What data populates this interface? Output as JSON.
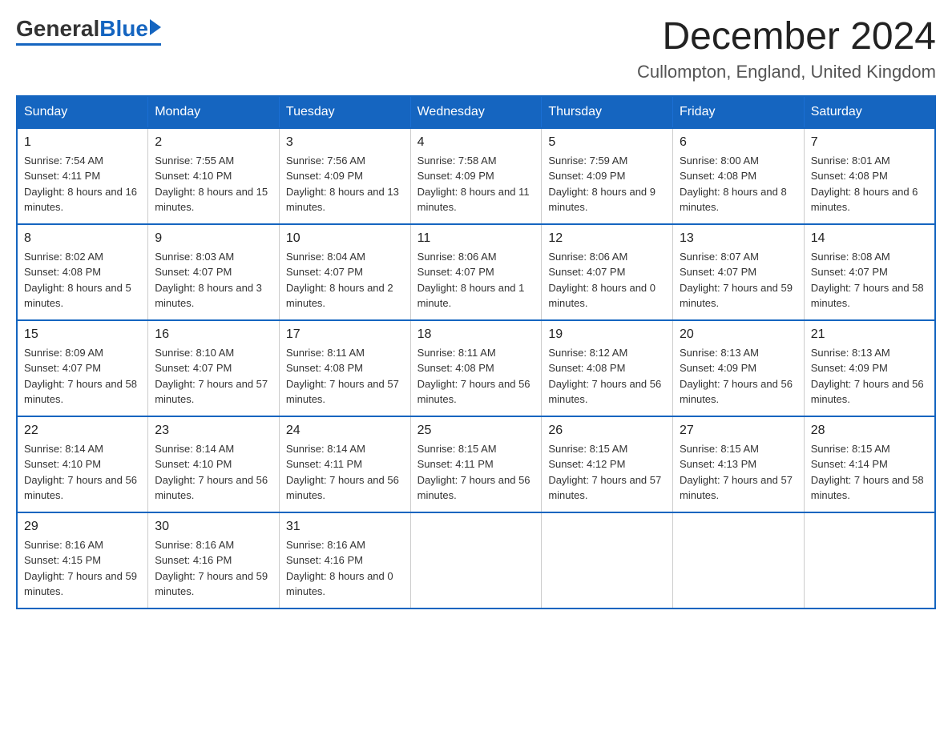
{
  "header": {
    "logo_general": "General",
    "logo_blue": "Blue",
    "month_title": "December 2024",
    "location": "Cullompton, England, United Kingdom"
  },
  "days_of_week": [
    "Sunday",
    "Monday",
    "Tuesday",
    "Wednesday",
    "Thursday",
    "Friday",
    "Saturday"
  ],
  "weeks": [
    [
      {
        "day": "1",
        "sunrise": "Sunrise: 7:54 AM",
        "sunset": "Sunset: 4:11 PM",
        "daylight": "Daylight: 8 hours and 16 minutes."
      },
      {
        "day": "2",
        "sunrise": "Sunrise: 7:55 AM",
        "sunset": "Sunset: 4:10 PM",
        "daylight": "Daylight: 8 hours and 15 minutes."
      },
      {
        "day": "3",
        "sunrise": "Sunrise: 7:56 AM",
        "sunset": "Sunset: 4:09 PM",
        "daylight": "Daylight: 8 hours and 13 minutes."
      },
      {
        "day": "4",
        "sunrise": "Sunrise: 7:58 AM",
        "sunset": "Sunset: 4:09 PM",
        "daylight": "Daylight: 8 hours and 11 minutes."
      },
      {
        "day": "5",
        "sunrise": "Sunrise: 7:59 AM",
        "sunset": "Sunset: 4:09 PM",
        "daylight": "Daylight: 8 hours and 9 minutes."
      },
      {
        "day": "6",
        "sunrise": "Sunrise: 8:00 AM",
        "sunset": "Sunset: 4:08 PM",
        "daylight": "Daylight: 8 hours and 8 minutes."
      },
      {
        "day": "7",
        "sunrise": "Sunrise: 8:01 AM",
        "sunset": "Sunset: 4:08 PM",
        "daylight": "Daylight: 8 hours and 6 minutes."
      }
    ],
    [
      {
        "day": "8",
        "sunrise": "Sunrise: 8:02 AM",
        "sunset": "Sunset: 4:08 PM",
        "daylight": "Daylight: 8 hours and 5 minutes."
      },
      {
        "day": "9",
        "sunrise": "Sunrise: 8:03 AM",
        "sunset": "Sunset: 4:07 PM",
        "daylight": "Daylight: 8 hours and 3 minutes."
      },
      {
        "day": "10",
        "sunrise": "Sunrise: 8:04 AM",
        "sunset": "Sunset: 4:07 PM",
        "daylight": "Daylight: 8 hours and 2 minutes."
      },
      {
        "day": "11",
        "sunrise": "Sunrise: 8:06 AM",
        "sunset": "Sunset: 4:07 PM",
        "daylight": "Daylight: 8 hours and 1 minute."
      },
      {
        "day": "12",
        "sunrise": "Sunrise: 8:06 AM",
        "sunset": "Sunset: 4:07 PM",
        "daylight": "Daylight: 8 hours and 0 minutes."
      },
      {
        "day": "13",
        "sunrise": "Sunrise: 8:07 AM",
        "sunset": "Sunset: 4:07 PM",
        "daylight": "Daylight: 7 hours and 59 minutes."
      },
      {
        "day": "14",
        "sunrise": "Sunrise: 8:08 AM",
        "sunset": "Sunset: 4:07 PM",
        "daylight": "Daylight: 7 hours and 58 minutes."
      }
    ],
    [
      {
        "day": "15",
        "sunrise": "Sunrise: 8:09 AM",
        "sunset": "Sunset: 4:07 PM",
        "daylight": "Daylight: 7 hours and 58 minutes."
      },
      {
        "day": "16",
        "sunrise": "Sunrise: 8:10 AM",
        "sunset": "Sunset: 4:07 PM",
        "daylight": "Daylight: 7 hours and 57 minutes."
      },
      {
        "day": "17",
        "sunrise": "Sunrise: 8:11 AM",
        "sunset": "Sunset: 4:08 PM",
        "daylight": "Daylight: 7 hours and 57 minutes."
      },
      {
        "day": "18",
        "sunrise": "Sunrise: 8:11 AM",
        "sunset": "Sunset: 4:08 PM",
        "daylight": "Daylight: 7 hours and 56 minutes."
      },
      {
        "day": "19",
        "sunrise": "Sunrise: 8:12 AM",
        "sunset": "Sunset: 4:08 PM",
        "daylight": "Daylight: 7 hours and 56 minutes."
      },
      {
        "day": "20",
        "sunrise": "Sunrise: 8:13 AM",
        "sunset": "Sunset: 4:09 PM",
        "daylight": "Daylight: 7 hours and 56 minutes."
      },
      {
        "day": "21",
        "sunrise": "Sunrise: 8:13 AM",
        "sunset": "Sunset: 4:09 PM",
        "daylight": "Daylight: 7 hours and 56 minutes."
      }
    ],
    [
      {
        "day": "22",
        "sunrise": "Sunrise: 8:14 AM",
        "sunset": "Sunset: 4:10 PM",
        "daylight": "Daylight: 7 hours and 56 minutes."
      },
      {
        "day": "23",
        "sunrise": "Sunrise: 8:14 AM",
        "sunset": "Sunset: 4:10 PM",
        "daylight": "Daylight: 7 hours and 56 minutes."
      },
      {
        "day": "24",
        "sunrise": "Sunrise: 8:14 AM",
        "sunset": "Sunset: 4:11 PM",
        "daylight": "Daylight: 7 hours and 56 minutes."
      },
      {
        "day": "25",
        "sunrise": "Sunrise: 8:15 AM",
        "sunset": "Sunset: 4:11 PM",
        "daylight": "Daylight: 7 hours and 56 minutes."
      },
      {
        "day": "26",
        "sunrise": "Sunrise: 8:15 AM",
        "sunset": "Sunset: 4:12 PM",
        "daylight": "Daylight: 7 hours and 57 minutes."
      },
      {
        "day": "27",
        "sunrise": "Sunrise: 8:15 AM",
        "sunset": "Sunset: 4:13 PM",
        "daylight": "Daylight: 7 hours and 57 minutes."
      },
      {
        "day": "28",
        "sunrise": "Sunrise: 8:15 AM",
        "sunset": "Sunset: 4:14 PM",
        "daylight": "Daylight: 7 hours and 58 minutes."
      }
    ],
    [
      {
        "day": "29",
        "sunrise": "Sunrise: 8:16 AM",
        "sunset": "Sunset: 4:15 PM",
        "daylight": "Daylight: 7 hours and 59 minutes."
      },
      {
        "day": "30",
        "sunrise": "Sunrise: 8:16 AM",
        "sunset": "Sunset: 4:16 PM",
        "daylight": "Daylight: 7 hours and 59 minutes."
      },
      {
        "day": "31",
        "sunrise": "Sunrise: 8:16 AM",
        "sunset": "Sunset: 4:16 PM",
        "daylight": "Daylight: 8 hours and 0 minutes."
      },
      null,
      null,
      null,
      null
    ]
  ]
}
